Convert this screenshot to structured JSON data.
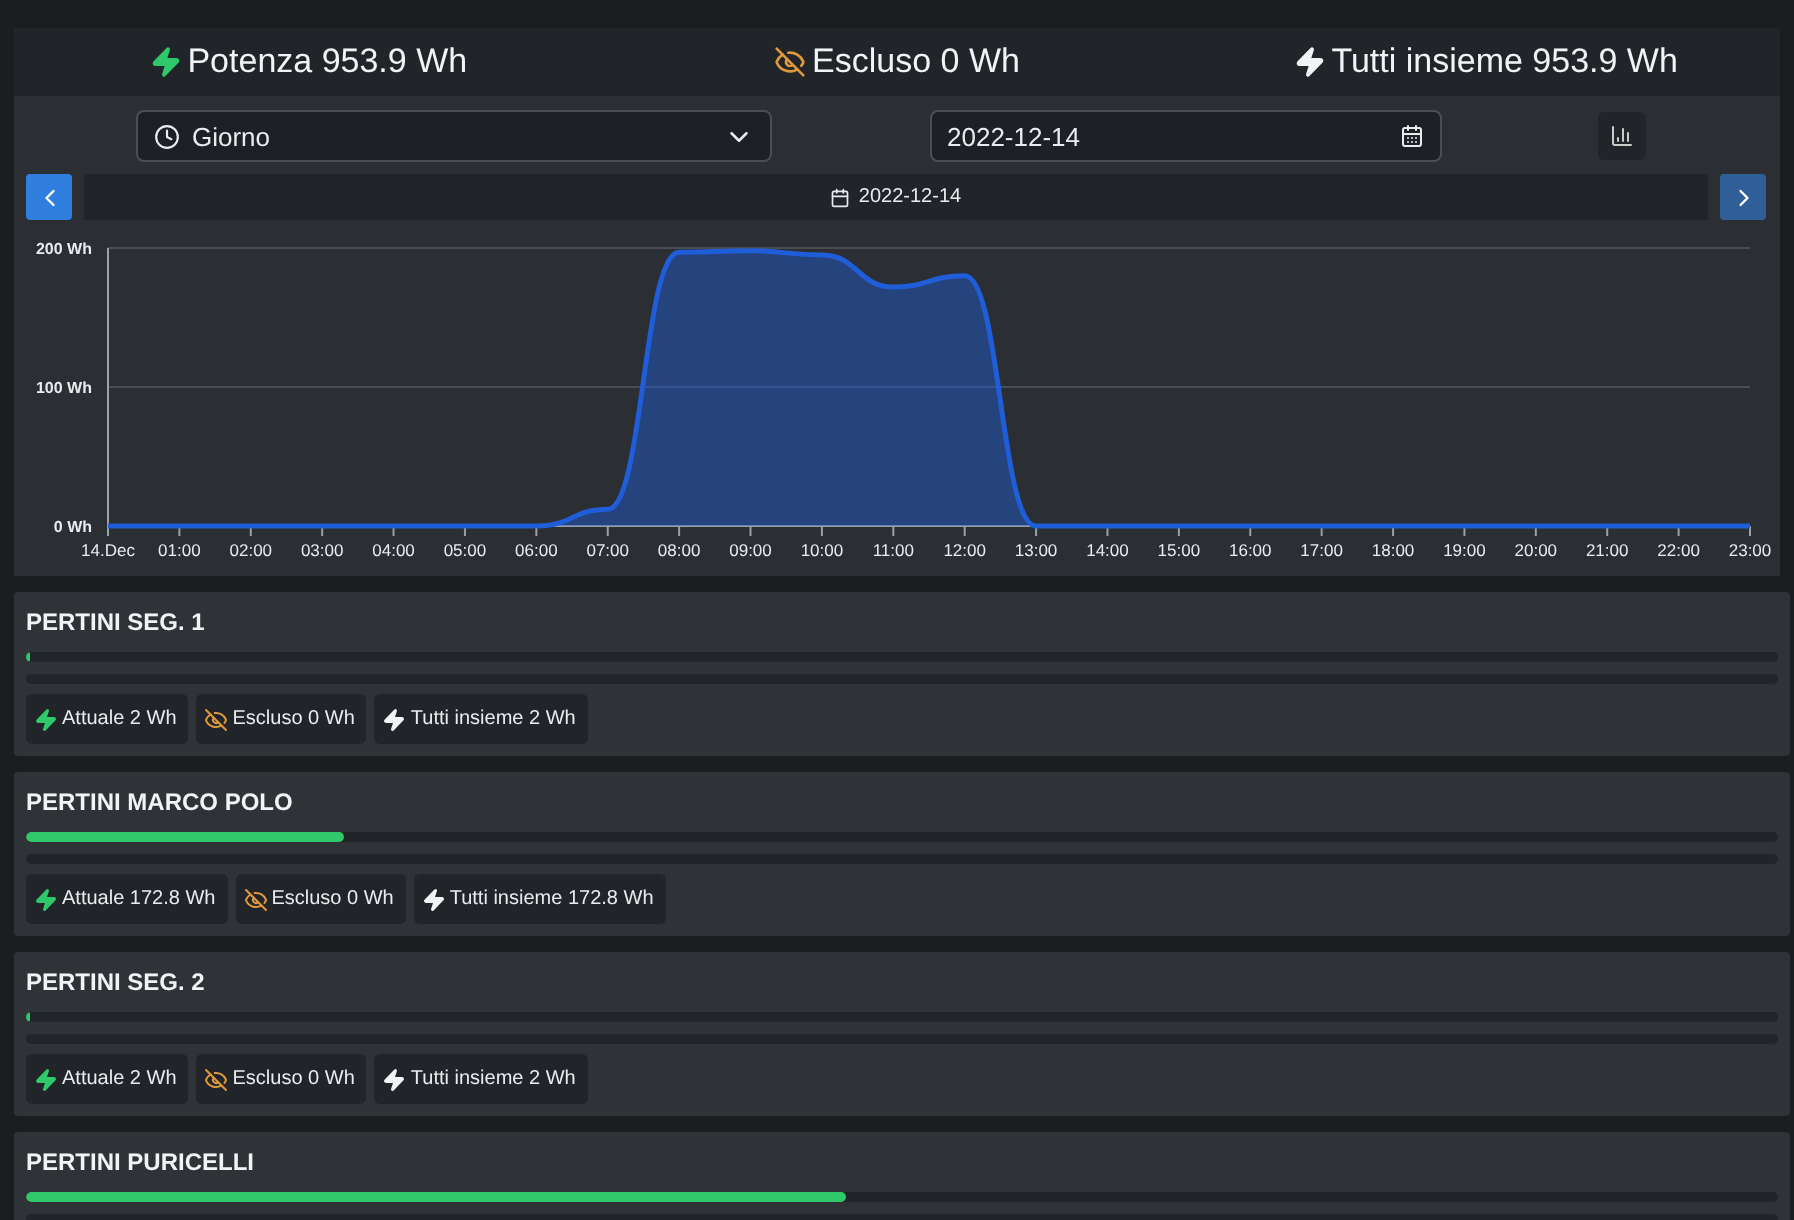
{
  "summary": [
    {
      "kind": "power",
      "text": "Potenza 953.9 Wh"
    },
    {
      "kind": "excluded",
      "text": "Escluso 0 Wh"
    },
    {
      "kind": "total",
      "text": "Tutti insieme 953.9 Wh"
    }
  ],
  "period_select": {
    "value": "Giorno"
  },
  "date_field": {
    "value": "2022-12-14"
  },
  "nav": {
    "date": "2022-12-14"
  },
  "chart_data": {
    "type": "area",
    "categories": [
      "14.Dec",
      "01:00",
      "02:00",
      "03:00",
      "04:00",
      "05:00",
      "06:00",
      "07:00",
      "08:00",
      "09:00",
      "10:00",
      "11:00",
      "12:00",
      "13:00",
      "14:00",
      "15:00",
      "16:00",
      "17:00",
      "18:00",
      "19:00",
      "20:00",
      "21:00",
      "22:00",
      "23:00"
    ],
    "ylim": [
      0,
      200
    ],
    "yticks": [
      {
        "value": 0,
        "label": "0 Wh"
      },
      {
        "value": 100,
        "label": "100 Wh"
      },
      {
        "value": 200,
        "label": "200 Wh"
      }
    ],
    "series": [
      {
        "color": "#1f5ed8",
        "values": [
          0,
          0,
          0,
          0,
          0,
          0,
          0,
          12,
          197,
          198,
          195,
          172,
          180,
          0,
          0,
          0,
          0,
          0,
          0,
          0,
          0,
          0,
          0,
          0
        ]
      }
    ]
  },
  "segments": [
    {
      "name": "PERTINI SEG. 1",
      "level": 0.002,
      "chips": [
        {
          "kind": "power",
          "text": "Attuale 2 Wh"
        },
        {
          "kind": "excluded",
          "text": "Escluso 0 Wh"
        },
        {
          "kind": "total",
          "text": "Tutti insieme 2 Wh"
        }
      ]
    },
    {
      "name": "PERTINI MARCO POLO",
      "level": 0.181,
      "chips": [
        {
          "kind": "power",
          "text": "Attuale 172.8 Wh"
        },
        {
          "kind": "excluded",
          "text": "Escluso 0 Wh"
        },
        {
          "kind": "total",
          "text": "Tutti insieme 172.8 Wh"
        }
      ]
    },
    {
      "name": "PERTINI SEG. 2",
      "level": 0.002,
      "chips": [
        {
          "kind": "power",
          "text": "Attuale 2 Wh"
        },
        {
          "kind": "excluded",
          "text": "Escluso 0 Wh"
        },
        {
          "kind": "total",
          "text": "Tutti insieme 2 Wh"
        }
      ]
    },
    {
      "name": "PERTINI PURICELLI",
      "level": 0.468
    }
  ]
}
